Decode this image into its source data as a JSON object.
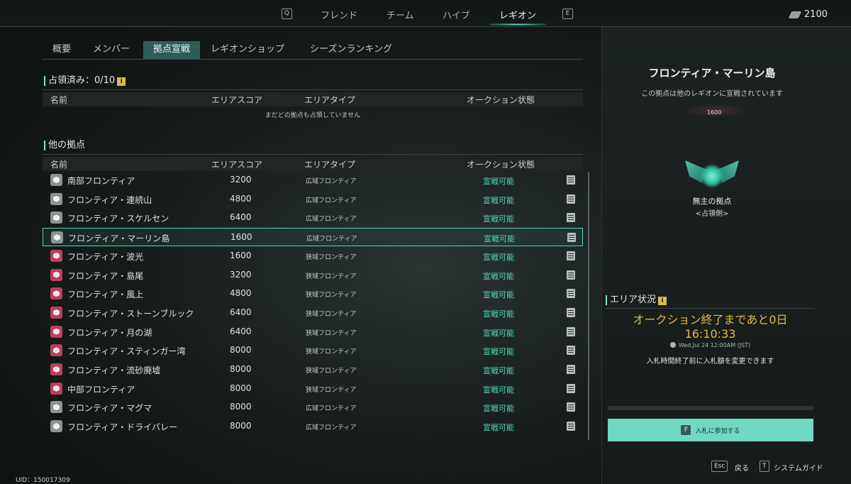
{
  "topnav": {
    "left_key": "Q",
    "right_key": "E",
    "tabs": [
      "フレンド",
      "チーム",
      "ハイブ",
      "レギオン"
    ],
    "active_tab": "レギオン",
    "currency_icon": "gem-icon",
    "currency_amount": "2100"
  },
  "subtabs": [
    "概要",
    "メンバー",
    "拠点宣戦",
    "レギオンショップ",
    "シーズンランキング"
  ],
  "occupied": {
    "title": "占領済み：0/10",
    "info_icon": "i",
    "headers": {
      "name": "名前",
      "score": "エリアスコア",
      "type": "エリアタイプ",
      "status": "オークション状態"
    },
    "empty_message": "まだどの拠点も占領していません"
  },
  "others": {
    "title": "他の拠点",
    "headers": {
      "name": "名前",
      "score": "エリアスコア",
      "type": "エリアタイプ",
      "status": "オークション状態"
    },
    "rows": [
      {
        "icon": "gray",
        "name": "南部フロンティア",
        "score": "3200",
        "type": "広域フロンティア",
        "status": "宣戦可能"
      },
      {
        "icon": "gray",
        "name": "フロンティア・連続山",
        "score": "4800",
        "type": "広域フロンティア",
        "status": "宣戦可能"
      },
      {
        "icon": "gray",
        "name": "フロンティア・スケルセン",
        "score": "6400",
        "type": "広域フロンティア",
        "status": "宣戦可能"
      },
      {
        "icon": "gray",
        "name": "フロンティア・マーリン島",
        "score": "1600",
        "type": "広域フロンティア",
        "status": "宣戦可能",
        "selected": true
      },
      {
        "icon": "red",
        "name": "フロンティア・波光",
        "score": "1600",
        "type": "狭域フロンティア",
        "status": "宣戦可能"
      },
      {
        "icon": "red",
        "name": "フロンティア・島尾",
        "score": "3200",
        "type": "狭域フロンティア",
        "status": "宣戦可能"
      },
      {
        "icon": "red",
        "name": "フロンティア・風上",
        "score": "4800",
        "type": "狭域フロンティア",
        "status": "宣戦可能"
      },
      {
        "icon": "red",
        "name": "フロンティア・ストーンブルック",
        "score": "6400",
        "type": "狭域フロンティア",
        "status": "宣戦可能"
      },
      {
        "icon": "red",
        "name": "フロンティア・月の湖",
        "score": "6400",
        "type": "狭域フロンティア",
        "status": "宣戦可能"
      },
      {
        "icon": "red",
        "name": "フロンティア・スティンガー湾",
        "score": "8000",
        "type": "狭域フロンティア",
        "status": "宣戦可能"
      },
      {
        "icon": "red",
        "name": "フロンティア・流砂廃墟",
        "score": "8000",
        "type": "狭域フロンティア",
        "status": "宣戦可能"
      },
      {
        "icon": "red",
        "name": "中部フロンティア",
        "score": "8000",
        "type": "狭域フロンティア",
        "status": "宣戦可能"
      },
      {
        "icon": "gray",
        "name": "フロンティア・マグマ",
        "score": "8000",
        "type": "広域フロンティア",
        "status": "宣戦可能"
      },
      {
        "icon": "gray",
        "name": "フロンティア・ドライバレー",
        "score": "8000",
        "type": "広域フロンティア",
        "status": "宣戦可能"
      }
    ]
  },
  "detail": {
    "title": "フロンティア・マーリン島",
    "subtitle": "この拠点は他のレギオンに宣戦されています",
    "score": "1600",
    "emblem_label": "無主の拠点",
    "emblem_sub": "<占領側>",
    "area_title": "エリア状況",
    "countdown_line1": "オークション終了まであと0日",
    "countdown_line2": "16:10:33",
    "end_time": "Wed,Jul 24 12:00AM (JST)",
    "bid_note": "入札時間終了前に入札額を変更できます",
    "bid_key": "F",
    "bid_button": "入札に参加する"
  },
  "footer": {
    "back_key": "Esc",
    "back_label": "戻る",
    "guide_key": "T",
    "guide_label": "システムガイド",
    "uid": "UID：150017309"
  },
  "colors": {
    "accent": "#56d3b8",
    "status_green": "#4fdcb8",
    "gold": "#e3b94a",
    "button": "#6fd9c2",
    "icon_red": "#b8405e",
    "icon_gray": "#8d9392"
  }
}
